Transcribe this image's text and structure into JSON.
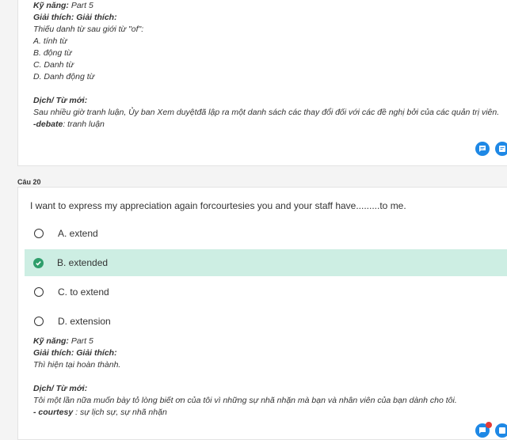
{
  "prev_card": {
    "skill_label": "Kỹ năng:",
    "skill_value": "Part 5",
    "explain_label": "Giải thích: Giải thích:",
    "explain_lines": [
      "Thiếu danh từ sau giới từ \"of\":",
      "A. tính từ",
      "B. động từ",
      "C. Danh từ",
      "D. Danh động từ"
    ],
    "vocab_label": "Dịch/ Từ mới:",
    "vocab_line": "Sau nhiều giờ tranh luận, Ủy ban Xem duyệtđã lập ra một danh sách các thay đổi đối với các đề nghị bởi của các quản trị viên.",
    "vocab_word": "-debate",
    "vocab_word_meaning": ": tranh luận"
  },
  "question": {
    "label": "Câu 20",
    "text": "I want to express my appreciation again forcourtesies you and your staff have.........to me.",
    "options": [
      {
        "label": "A. extend",
        "selected": false
      },
      {
        "label": "B. extended",
        "selected": true
      },
      {
        "label": "C. to extend",
        "selected": false
      },
      {
        "label": "D. extension",
        "selected": false
      }
    ],
    "skill_label": "Kỹ năng:",
    "skill_value": "Part 5",
    "explain_label": "Giải thích: Giải thích:",
    "explain_line": "Thì hiện tại hoàn thành.",
    "vocab_label": "Dịch/ Từ mới:",
    "vocab_line": "Tôi một lần nữa muốn bày tỏ lòng biết ơn của tôi vì những sự nhã nhặn mà bạn và nhân viên của bạn dành cho tôi.",
    "vocab_word": "- courtesy",
    "vocab_word_meaning": " : sự lịch sự, sự nhã nhặn"
  },
  "icons": {
    "comment": "comment-icon",
    "note": "note-icon",
    "accent": "#1e88e5",
    "correct": "#2e9e6b",
    "selected_bg": "#cdeee3"
  }
}
